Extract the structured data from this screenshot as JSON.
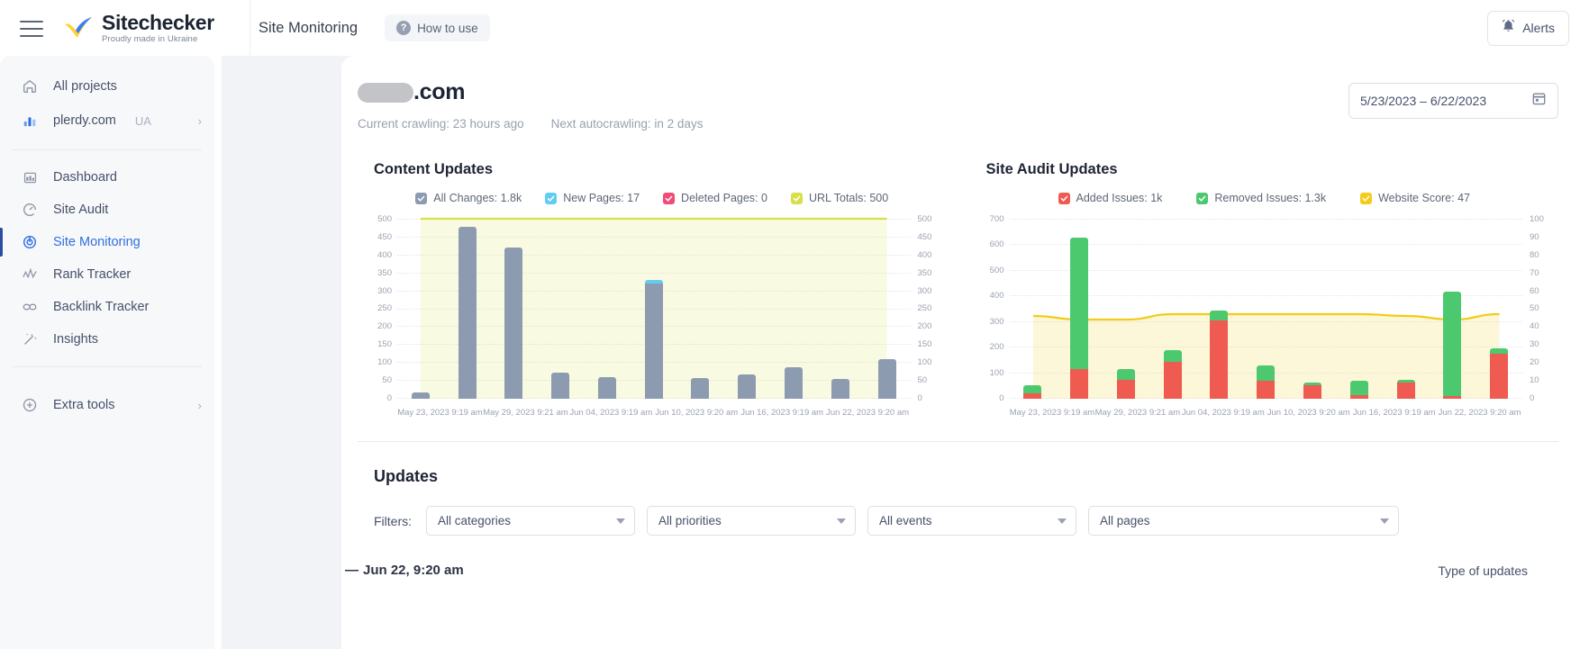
{
  "brand": {
    "name": "Sitechecker",
    "tagline": "Proudly made in Ukraine",
    "menu_icon": "hamburger-icon"
  },
  "topbar": {
    "page_title": "Site Monitoring",
    "how_to_use": "How to use",
    "alerts": "Alerts"
  },
  "sidebar": {
    "items": [
      {
        "label": "All projects",
        "icon": "home-icon",
        "active": false
      },
      {
        "label": "plerdy.com",
        "tag": "UA",
        "icon": "project-chart-icon",
        "active": false,
        "chevron": "›"
      },
      {
        "label": "Dashboard",
        "icon": "dashboard-icon",
        "active": false
      },
      {
        "label": "Site Audit",
        "icon": "gauge-icon",
        "active": false
      },
      {
        "label": "Site Monitoring",
        "icon": "target-icon",
        "active": true
      },
      {
        "label": "Rank Tracker",
        "icon": "trend-icon",
        "active": false
      },
      {
        "label": "Backlink Tracker",
        "icon": "link-icon",
        "active": false
      },
      {
        "label": "Insights",
        "icon": "magic-wand-icon",
        "active": false
      },
      {
        "label": "Extra tools",
        "icon": "plus-circle-icon",
        "active": false,
        "chevron": "›"
      }
    ]
  },
  "site": {
    "domain_suffix": ".com",
    "domain_redacted": true,
    "current_crawling": "Current crawling: 23 hours ago",
    "next_autocrawling": "Next autocrawling: in 2 days",
    "date_range": "5/23/2023 – 6/22/2023"
  },
  "colors": {
    "all_changes": "#8d9bb0",
    "new_pages": "#63cdf1",
    "deleted_pages": "#ef4d77",
    "url_totals": "#d7e04b",
    "added_issues": "#ef5a51",
    "removed_issues": "#4cc96f",
    "website_score": "#f2cc18",
    "accent": "#2f6fe0"
  },
  "chart_data": [
    {
      "type": "bar",
      "title": "Content Updates",
      "legend": [
        {
          "label": "All Changes: 1.8k",
          "color": "#8d9bb0",
          "checked": true
        },
        {
          "label": "New Pages: 17",
          "color": "#63cdf1",
          "checked": true
        },
        {
          "label": "Deleted Pages: 0",
          "color": "#ef4d77",
          "checked": true
        },
        {
          "label": "URL Totals: 500",
          "color": "#d7e04b",
          "checked": true
        }
      ],
      "ylim": [
        0,
        500
      ],
      "yticks": [
        500,
        450,
        400,
        350,
        300,
        250,
        200,
        150,
        100,
        50,
        0
      ],
      "y2lim": [
        0,
        500
      ],
      "y2ticks": [
        500,
        450,
        400,
        350,
        300,
        250,
        200,
        150,
        100,
        50,
        0
      ],
      "grid": true,
      "categories": [
        "May 23, 2023 9:19 am",
        "",
        "May 29, 2023 9:21 am",
        "",
        "Jun 04, 2023 9:19 am",
        "",
        "Jun 10, 2023 9:20 am",
        "",
        "Jun 16, 2023 9:19 am",
        "",
        "Jun 22, 2023 9:20 am"
      ],
      "xtick_labels": [
        "May 23, 2023 9:19 am",
        "May 29, 2023 9:21 am",
        "Jun 04, 2023 9:19 am",
        "Jun 10, 2023 9:20 am",
        "Jun 16, 2023 9:19 am",
        "Jun 22, 2023 9:20 am"
      ],
      "series": [
        {
          "name": "All Changes",
          "color": "#8d9bb0",
          "values": [
            17,
            478,
            420,
            72,
            60,
            320,
            57,
            68,
            87,
            55,
            110
          ]
        },
        {
          "name": "New Pages",
          "color": "#63cdf1",
          "values": [
            0,
            0,
            0,
            0,
            0,
            9,
            0,
            0,
            0,
            0,
            0
          ]
        },
        {
          "name": "Deleted Pages",
          "color": "#ef4d77",
          "values": [
            0,
            0,
            0,
            0,
            0,
            0,
            0,
            0,
            0,
            0,
            0
          ]
        }
      ],
      "line": {
        "name": "URL Totals",
        "color": "#d7e04b",
        "area": true,
        "values": [
          500,
          500,
          500,
          500,
          500,
          500,
          500,
          500,
          500,
          500,
          500
        ]
      }
    },
    {
      "type": "bar",
      "title": "Site Audit Updates",
      "legend": [
        {
          "label": "Added Issues: 1k",
          "color": "#ef5a51",
          "checked": true
        },
        {
          "label": "Removed Issues: 1.3k",
          "color": "#4cc96f",
          "checked": true
        },
        {
          "label": "Website Score: 47",
          "color": "#f2cc18",
          "checked": true
        }
      ],
      "ylim": [
        0,
        700
      ],
      "yticks": [
        700,
        600,
        500,
        400,
        300,
        200,
        100,
        0
      ],
      "y2lim": [
        0,
        100
      ],
      "y2ticks": [
        100,
        90,
        80,
        70,
        60,
        50,
        40,
        30,
        20,
        10,
        0
      ],
      "grid": true,
      "xtick_labels": [
        "May 23, 2023 9:19 am",
        "May 29, 2023 9:21 am",
        "Jun 04, 2023 9:19 am",
        "Jun 10, 2023 9:20 am",
        "Jun 16, 2023 9:19 am",
        "Jun 22, 2023 9:20 am"
      ],
      "series": [
        {
          "name": "Added Issues",
          "color": "#ef5a51",
          "values": [
            22,
            115,
            72,
            143,
            305,
            70,
            52,
            15,
            62,
            10,
            175
          ]
        },
        {
          "name": "Removed Issues",
          "color": "#4cc96f",
          "values": [
            30,
            510,
            45,
            45,
            38,
            60,
            10,
            55,
            10,
            408,
            20
          ]
        }
      ],
      "line": {
        "name": "Website Score",
        "color": "#f2cc18",
        "area": true,
        "axis": "right",
        "values": [
          46,
          44,
          44,
          47,
          47,
          47,
          47,
          47,
          46,
          44,
          47
        ]
      }
    }
  ],
  "updates": {
    "title": "Updates",
    "filters_label": "Filters:",
    "filters": [
      {
        "name": "categories",
        "value": "All categories"
      },
      {
        "name": "priorities",
        "value": "All priorities"
      },
      {
        "name": "events",
        "value": "All events"
      },
      {
        "name": "pages",
        "value": "All pages"
      }
    ],
    "row_date": "Jun 22, 9:20 am",
    "row_dash": "—",
    "type_of_updates": "Type of updates"
  }
}
